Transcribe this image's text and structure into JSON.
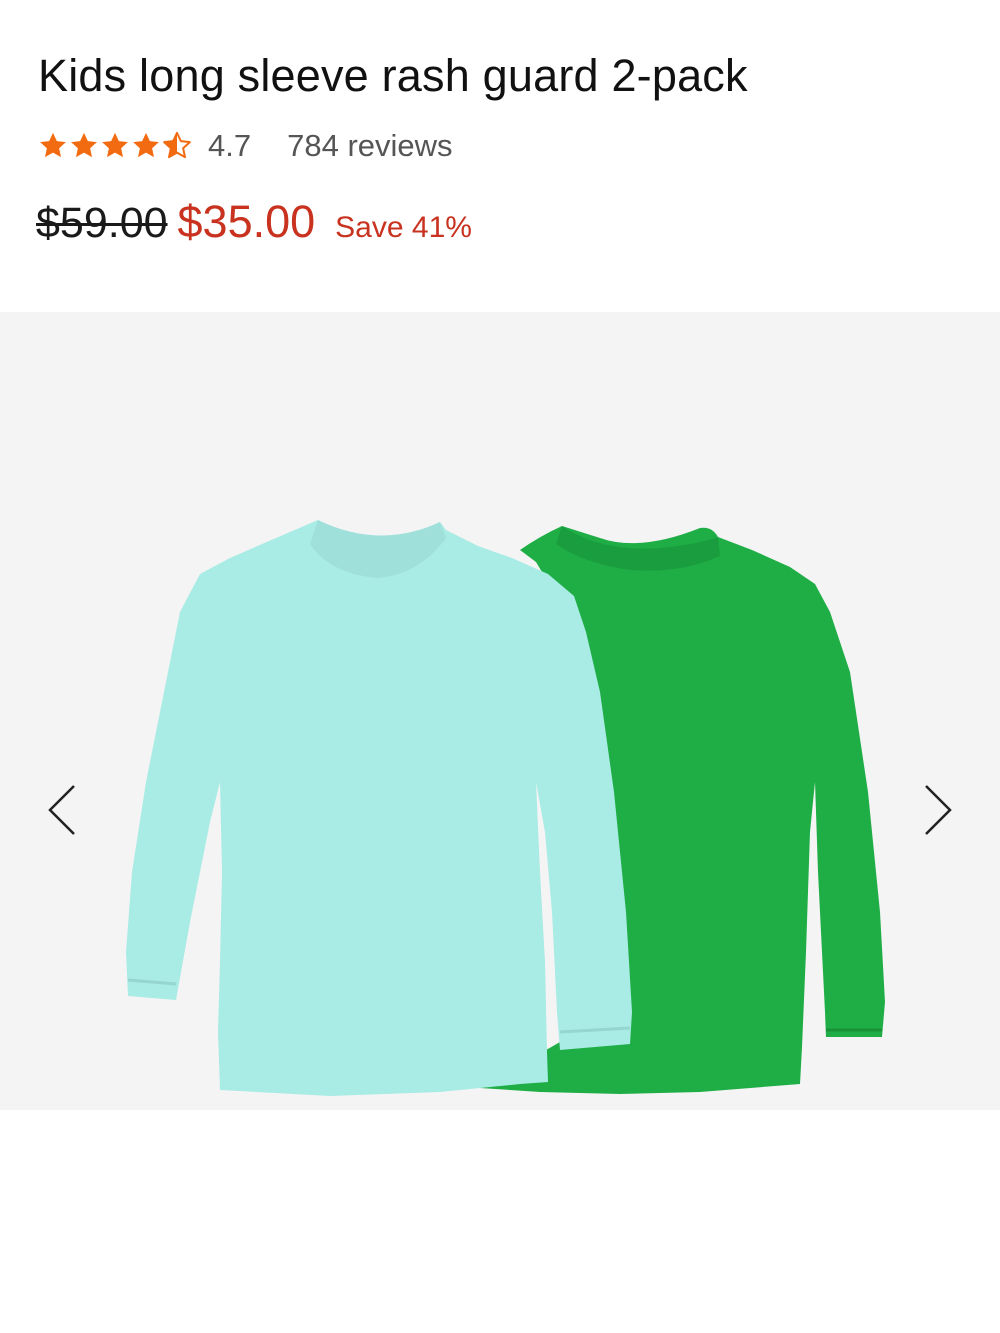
{
  "product": {
    "title": "Kids long sleeve rash guard 2-pack",
    "rating": {
      "stars_value": 4.7,
      "value": "4.7",
      "reviews": "784 reviews",
      "star_color": "#f26b10"
    },
    "price": {
      "original": "$59.00",
      "sale": "$35.00",
      "savings": "Save 41%",
      "sale_color": "#c8321f"
    }
  },
  "gallery": {
    "background": "#f4f4f5",
    "items": [
      {
        "name": "aqua rash guard",
        "color": "#a9ebe5"
      },
      {
        "name": "green rash guard",
        "color": "#1fae46"
      }
    ],
    "prev_icon": "chevron-left-icon",
    "next_icon": "chevron-right-icon"
  }
}
